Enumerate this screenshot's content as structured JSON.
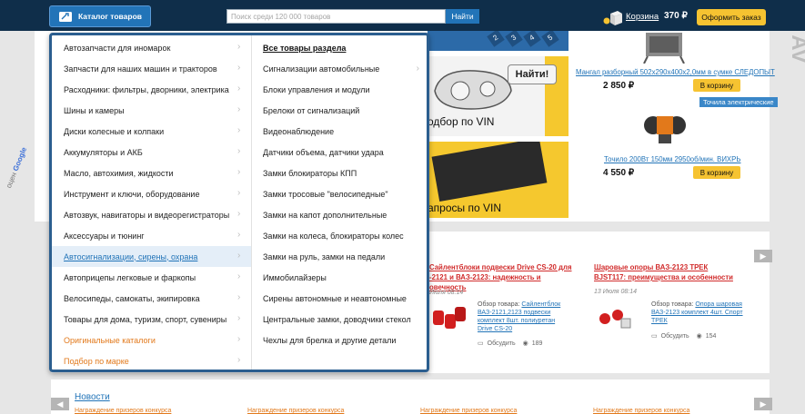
{
  "header": {
    "catalog_button": "Каталог товаров",
    "search_placeholder": "Поиск среди 120 000 товаров",
    "search_button": "Найти",
    "cart_label": "Корзина",
    "cart_total": "370 ₽",
    "order_button": "Оформить заказ"
  },
  "colors": {
    "header_bg": "#0f2e4a",
    "accent_blue": "#2274b8",
    "button_yellow": "#f6c331",
    "menu_border": "#2b5e8f",
    "article_red": "#d12b2b",
    "link_orange": "#e2791b"
  },
  "icons": {
    "catalog": "catalog-wrench-icon",
    "cart": "cart-box-icon",
    "chevron": "chevron-right-icon",
    "comment": "comment-icon",
    "eye": "eye-icon",
    "arrow_left": "arrow-left-icon",
    "arrow_right": "arrow-right-icon"
  },
  "catalog_menu": {
    "categories": [
      {
        "label": "Автозапчасти для иномарок"
      },
      {
        "label": "Запчасти для наших машин и тракторов"
      },
      {
        "label": "Расходники: фильтры, дворники, электрика"
      },
      {
        "label": "Шины и камеры"
      },
      {
        "label": "Диски колесные и колпаки"
      },
      {
        "label": "Аккумуляторы и АКБ"
      },
      {
        "label": "Масло, автохимия, жидкости"
      },
      {
        "label": "Инструмент и ключи, оборудование"
      },
      {
        "label": "Автозвук, навигаторы и видеорегистраторы"
      },
      {
        "label": "Аксессуары и тюнинг"
      },
      {
        "label": "Автосигнализации, сирены, охрана"
      },
      {
        "label": "Автоприцепы легковые и фаркопы"
      },
      {
        "label": "Велосипеды, самокаты, экипировка"
      },
      {
        "label": "Товары для дома, туризм, спорт, сувениры"
      },
      {
        "label": "Оригинальные каталоги"
      },
      {
        "label": "Подбор по марке"
      }
    ],
    "active_index": 10,
    "subcategories": [
      {
        "label": "Все товары раздела"
      },
      {
        "label": "Сигнализации автомобильные"
      },
      {
        "label": "Блоки управления и модули"
      },
      {
        "label": "Брелоки от сигнализаций"
      },
      {
        "label": "Видеонаблюдение"
      },
      {
        "label": "Датчики объема, датчики удара"
      },
      {
        "label": "Замки блокираторы КПП"
      },
      {
        "label": "Замки тросовые \"велосипедные\""
      },
      {
        "label": "Замки на капот дополнительные"
      },
      {
        "label": "Замки на колеса, блокираторы колес"
      },
      {
        "label": "Замки на руль, замки на педали"
      },
      {
        "label": "Иммобилайзеры"
      },
      {
        "label": "Сирены автономные и неавтономные"
      },
      {
        "label": "Центральные замки, доводчики стекол"
      },
      {
        "label": "Чехлы для брелка и другие детали"
      }
    ]
  },
  "banners": {
    "find_button": "Найти!",
    "vin_text_top": "одбор по VIN",
    "vin_text_bottom": "апросы по VIN",
    "strip_numbers": [
      "2",
      "3",
      "4",
      "5"
    ]
  },
  "products": [
    {
      "title": "Мангал разборный 502х290х400х2,0мм в сумке СЛЕДОПЫТ",
      "price": "2 850 ₽",
      "button": "В корзину"
    },
    {
      "badge": "Точила электрические",
      "title": "Точило 200Вт 150мм 2950об/мин. ВИХРЬ",
      "price": "4 550 ₽",
      "button": "В корзину"
    }
  ],
  "articles": [
    {
      "title_lines": [
        "Сайлентблоки подвески Drive CS-20 для",
        "-2121 и ВАЗ-2123: надежность и",
        "овечность"
      ],
      "date": "Июля 08:14",
      "desc_prefix": "Обзор товара: ",
      "desc_link_lines": [
        "Сайлентблок",
        "ВАЗ-2121,2123 подвески",
        "комплект 8шт. полиуретан",
        "Drive CS-20"
      ],
      "comments_label": "Обсудить",
      "views": "189"
    },
    {
      "title_lines": [
        "Шаровые опоры ВАЗ-2123 ТРЕК",
        "BJST117: преимущества и особенности"
      ],
      "date": "13 Июля 08:14",
      "desc_prefix": "Обзор товара: ",
      "desc_link_lines": [
        "Опора шаровая",
        "ВАЗ-2123 комплект 4шт. Спорт",
        "ТРЕК"
      ],
      "comments_label": "Обсудить",
      "views": "154"
    }
  ],
  "news": {
    "title": "Новости",
    "items": [
      "Награждение призеров конкурса",
      "Награждение призеров конкурса",
      "Награждение призеров конкурса",
      "Награждение призеров конкурса"
    ]
  },
  "watermark": {
    "google_label": "Google",
    "google_prefix": "оцен"
  }
}
